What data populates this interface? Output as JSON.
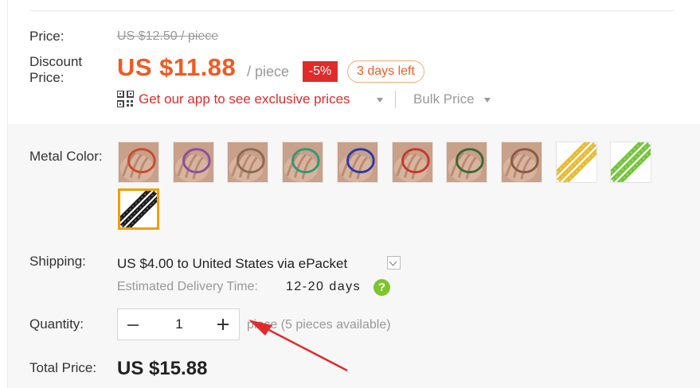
{
  "price": {
    "label": "Price:",
    "original": "US $12.50 / piece",
    "discount_label": "Discount\nPrice:",
    "discount_value": "US $11.88",
    "unit": "/ piece",
    "percent_off": "-5%",
    "days_left": "3 days left"
  },
  "promo": {
    "app_link": "Get our app to see exclusive prices",
    "bulk_price": "Bulk Price"
  },
  "metal_color": {
    "label": "Metal Color:",
    "selected_index": 10,
    "swatch_colors": [
      "#c94a2e",
      "#8a4fa0",
      "#8a6a52",
      "#2a9c78",
      "#2a3aa8",
      "#c43a2a",
      "#3a6a3a",
      "#8a5a48",
      "#e6b930",
      "#6fc434",
      "#1a1a1a"
    ]
  },
  "shipping": {
    "label": "Shipping:",
    "text": "US $4.00 to United States via ePacket",
    "eta_label": "Estimated Delivery Time:",
    "eta_value": "12-20 days"
  },
  "quantity": {
    "label": "Quantity:",
    "value": "1",
    "available": "piece (5 pieces available)"
  },
  "total": {
    "label": "Total Price:",
    "value": "US $15.88"
  },
  "colors": {
    "accent": "#f05a22",
    "discount_badge": "#e12b2b",
    "selected_border": "#f0a000",
    "help_icon": "#7cc52c",
    "arrow": "#e12b2b"
  },
  "icons": {
    "qr": "qr-code-icon",
    "help": "question-icon",
    "dropdown": "chevron-down-icon",
    "minus": "minus-icon",
    "plus": "plus-icon"
  }
}
